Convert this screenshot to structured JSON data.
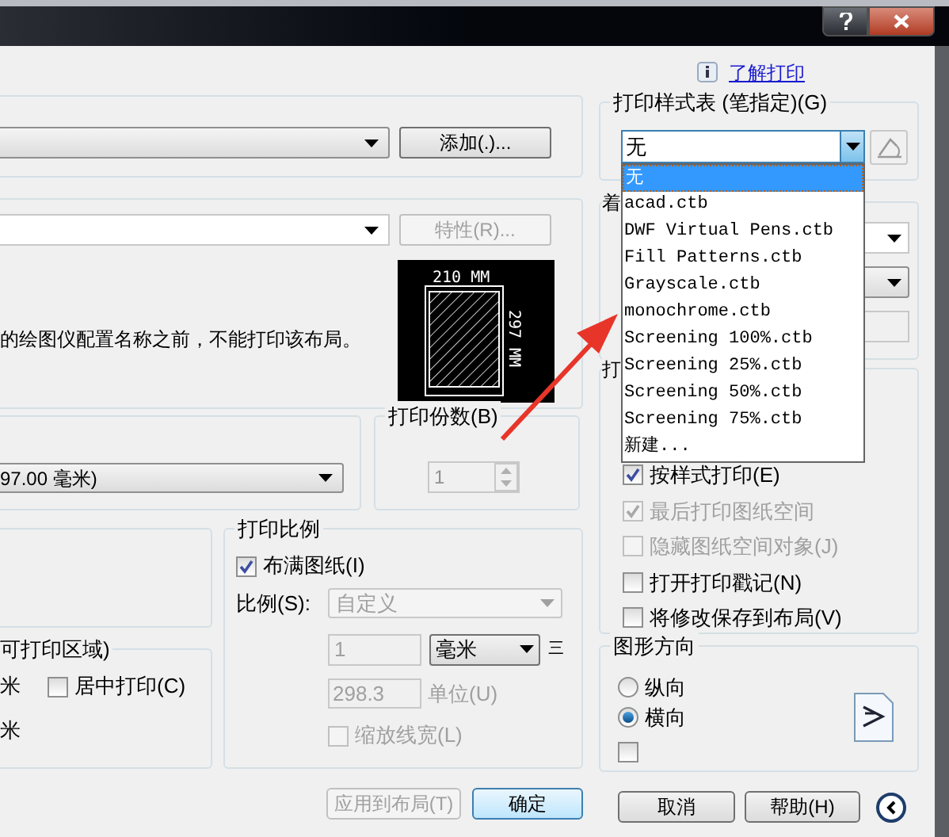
{
  "learn_link": "了解打印",
  "page_setup": {
    "add_button": "添加(.)..."
  },
  "printer": {
    "properties_button": "特性(R)...",
    "properties_disabled": true,
    "message": "的绘图仪配置名称之前，不能打印该布局。",
    "preview_width": "210 MM",
    "preview_height": "297 MM"
  },
  "paper_size": {
    "value": "97.00 毫米)"
  },
  "copies": {
    "label": "打印份数(B)",
    "value": "1",
    "disabled": true
  },
  "plot_offset": {
    "label": "可打印区域)",
    "unit_1": "米",
    "unit_2": "米",
    "center": {
      "label": "居中打印(C)",
      "checked": false,
      "disabled": false
    }
  },
  "scale": {
    "label": "打印比例",
    "fit": {
      "label": "布满图纸(I)",
      "checked": true,
      "disabled": false
    },
    "scale_label": "比例(S):",
    "scale_value": "自定义",
    "value_1": "1",
    "unit": "毫米",
    "equals": "三",
    "value_2": "298.3",
    "unit_label": "单位(U)",
    "lineweights": {
      "label": "缩放线宽(L)",
      "checked": false,
      "disabled": true
    }
  },
  "plot_style": {
    "label": "打印样式表 (笔指定)(G)",
    "value": "无",
    "options": [
      {
        "label": "无",
        "selected": true
      },
      {
        "label": "acad.ctb",
        "selected": false
      },
      {
        "label": "DWF Virtual Pens.ctb",
        "selected": false
      },
      {
        "label": "Fill Patterns.ctb",
        "selected": false
      },
      {
        "label": "Grayscale.ctb",
        "selected": false
      },
      {
        "label": "monochrome.ctb",
        "selected": false
      },
      {
        "label": "Screening 100%.ctb",
        "selected": false
      },
      {
        "label": "Screening 25%.ctb",
        "selected": false
      },
      {
        "label": "Screening 50%.ctb",
        "selected": false
      },
      {
        "label": "Screening 75%.ctb",
        "selected": false
      },
      {
        "label": "新建...",
        "selected": false
      }
    ]
  },
  "shaded_viewport": {
    "label": "着"
  },
  "plot_options": {
    "label": "打",
    "items": [
      {
        "label": "按样式打印(E)",
        "checked": true,
        "disabled": false
      },
      {
        "label": "最后打印图纸空间",
        "checked": true,
        "disabled": true
      },
      {
        "label": "隐藏图纸空间对象(J)",
        "checked": false,
        "disabled": true
      },
      {
        "label": "打开打印戳记(N)",
        "checked": false,
        "disabled": false
      },
      {
        "label": "将修改保存到布局(V)",
        "checked": false,
        "disabled": false
      }
    ]
  },
  "orientation": {
    "label": "图形方向",
    "options": [
      {
        "label": "纵向",
        "selected": false
      },
      {
        "label": "横向",
        "selected": true
      }
    ],
    "upside_down": {
      "checked": false
    }
  },
  "buttons": {
    "apply": "应用到布局(T)",
    "apply_disabled": true,
    "ok": "确定",
    "cancel": "取消",
    "help": "帮助(H)"
  }
}
